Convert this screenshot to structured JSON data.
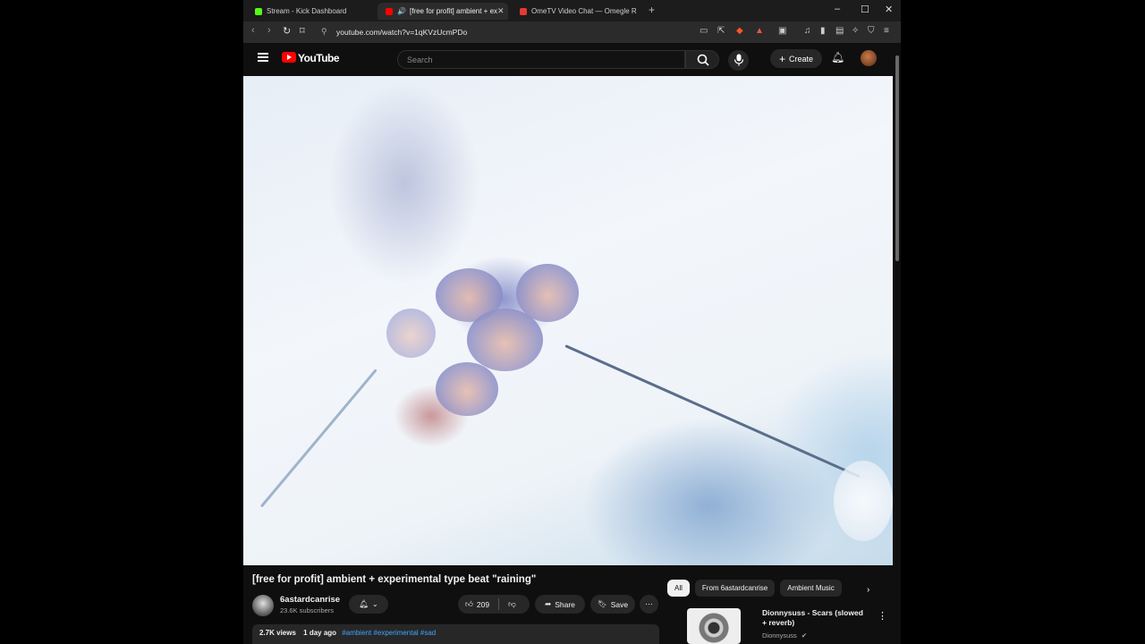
{
  "tabs": [
    {
      "label": "Stream - Kick Dashboard",
      "color": "#53fc18"
    },
    {
      "label": "[free for profit] ambient + ex",
      "color": "#ff0000"
    },
    {
      "label": "OmeTV Video Chat — Omegle R",
      "color": "#e53935"
    }
  ],
  "address": {
    "url": "youtube.com/watch?v=1qKVzUcmPDo"
  },
  "youtube": {
    "logo_text": "YouTube",
    "search_placeholder": "Search",
    "create_label": "Create"
  },
  "video": {
    "title": "[free for profit] ambient + experimental type beat \"raining\"",
    "channel": "6astardcanrise",
    "subscribers": "23.6K subscribers",
    "likes": "209",
    "share_label": "Share",
    "save_label": "Save",
    "views": "2.7K views",
    "age": "1 day ago",
    "hashtags": "#ambient #experimental #sad"
  },
  "chips": [
    "All",
    "From 6astardcanrise",
    "Ambient Music"
  ],
  "recommended": [
    {
      "title": "Dionnysuss - Scars (slowed + reverb)",
      "channel": "Dionnysuss"
    }
  ],
  "colors": {
    "accent": "#ff0000",
    "link": "#3ea6ff",
    "background": "#0f0f0f"
  }
}
